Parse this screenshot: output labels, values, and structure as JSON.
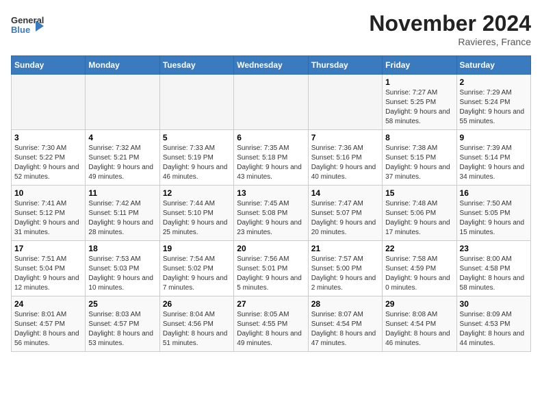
{
  "header": {
    "logo_line1": "General",
    "logo_line2": "Blue",
    "title": "November 2024",
    "subtitle": "Ravieres, France"
  },
  "days_of_week": [
    "Sunday",
    "Monday",
    "Tuesday",
    "Wednesday",
    "Thursday",
    "Friday",
    "Saturday"
  ],
  "weeks": [
    [
      {
        "day": "",
        "info": ""
      },
      {
        "day": "",
        "info": ""
      },
      {
        "day": "",
        "info": ""
      },
      {
        "day": "",
        "info": ""
      },
      {
        "day": "",
        "info": ""
      },
      {
        "day": "1",
        "info": "Sunrise: 7:27 AM\nSunset: 5:25 PM\nDaylight: 9 hours and 58 minutes."
      },
      {
        "day": "2",
        "info": "Sunrise: 7:29 AM\nSunset: 5:24 PM\nDaylight: 9 hours and 55 minutes."
      }
    ],
    [
      {
        "day": "3",
        "info": "Sunrise: 7:30 AM\nSunset: 5:22 PM\nDaylight: 9 hours and 52 minutes."
      },
      {
        "day": "4",
        "info": "Sunrise: 7:32 AM\nSunset: 5:21 PM\nDaylight: 9 hours and 49 minutes."
      },
      {
        "day": "5",
        "info": "Sunrise: 7:33 AM\nSunset: 5:19 PM\nDaylight: 9 hours and 46 minutes."
      },
      {
        "day": "6",
        "info": "Sunrise: 7:35 AM\nSunset: 5:18 PM\nDaylight: 9 hours and 43 minutes."
      },
      {
        "day": "7",
        "info": "Sunrise: 7:36 AM\nSunset: 5:16 PM\nDaylight: 9 hours and 40 minutes."
      },
      {
        "day": "8",
        "info": "Sunrise: 7:38 AM\nSunset: 5:15 PM\nDaylight: 9 hours and 37 minutes."
      },
      {
        "day": "9",
        "info": "Sunrise: 7:39 AM\nSunset: 5:14 PM\nDaylight: 9 hours and 34 minutes."
      }
    ],
    [
      {
        "day": "10",
        "info": "Sunrise: 7:41 AM\nSunset: 5:12 PM\nDaylight: 9 hours and 31 minutes."
      },
      {
        "day": "11",
        "info": "Sunrise: 7:42 AM\nSunset: 5:11 PM\nDaylight: 9 hours and 28 minutes."
      },
      {
        "day": "12",
        "info": "Sunrise: 7:44 AM\nSunset: 5:10 PM\nDaylight: 9 hours and 25 minutes."
      },
      {
        "day": "13",
        "info": "Sunrise: 7:45 AM\nSunset: 5:08 PM\nDaylight: 9 hours and 23 minutes."
      },
      {
        "day": "14",
        "info": "Sunrise: 7:47 AM\nSunset: 5:07 PM\nDaylight: 9 hours and 20 minutes."
      },
      {
        "day": "15",
        "info": "Sunrise: 7:48 AM\nSunset: 5:06 PM\nDaylight: 9 hours and 17 minutes."
      },
      {
        "day": "16",
        "info": "Sunrise: 7:50 AM\nSunset: 5:05 PM\nDaylight: 9 hours and 15 minutes."
      }
    ],
    [
      {
        "day": "17",
        "info": "Sunrise: 7:51 AM\nSunset: 5:04 PM\nDaylight: 9 hours and 12 minutes."
      },
      {
        "day": "18",
        "info": "Sunrise: 7:53 AM\nSunset: 5:03 PM\nDaylight: 9 hours and 10 minutes."
      },
      {
        "day": "19",
        "info": "Sunrise: 7:54 AM\nSunset: 5:02 PM\nDaylight: 9 hours and 7 minutes."
      },
      {
        "day": "20",
        "info": "Sunrise: 7:56 AM\nSunset: 5:01 PM\nDaylight: 9 hours and 5 minutes."
      },
      {
        "day": "21",
        "info": "Sunrise: 7:57 AM\nSunset: 5:00 PM\nDaylight: 9 hours and 2 minutes."
      },
      {
        "day": "22",
        "info": "Sunrise: 7:58 AM\nSunset: 4:59 PM\nDaylight: 9 hours and 0 minutes."
      },
      {
        "day": "23",
        "info": "Sunrise: 8:00 AM\nSunset: 4:58 PM\nDaylight: 8 hours and 58 minutes."
      }
    ],
    [
      {
        "day": "24",
        "info": "Sunrise: 8:01 AM\nSunset: 4:57 PM\nDaylight: 8 hours and 56 minutes."
      },
      {
        "day": "25",
        "info": "Sunrise: 8:03 AM\nSunset: 4:57 PM\nDaylight: 8 hours and 53 minutes."
      },
      {
        "day": "26",
        "info": "Sunrise: 8:04 AM\nSunset: 4:56 PM\nDaylight: 8 hours and 51 minutes."
      },
      {
        "day": "27",
        "info": "Sunrise: 8:05 AM\nSunset: 4:55 PM\nDaylight: 8 hours and 49 minutes."
      },
      {
        "day": "28",
        "info": "Sunrise: 8:07 AM\nSunset: 4:54 PM\nDaylight: 8 hours and 47 minutes."
      },
      {
        "day": "29",
        "info": "Sunrise: 8:08 AM\nSunset: 4:54 PM\nDaylight: 8 hours and 46 minutes."
      },
      {
        "day": "30",
        "info": "Sunrise: 8:09 AM\nSunset: 4:53 PM\nDaylight: 8 hours and 44 minutes."
      }
    ]
  ]
}
